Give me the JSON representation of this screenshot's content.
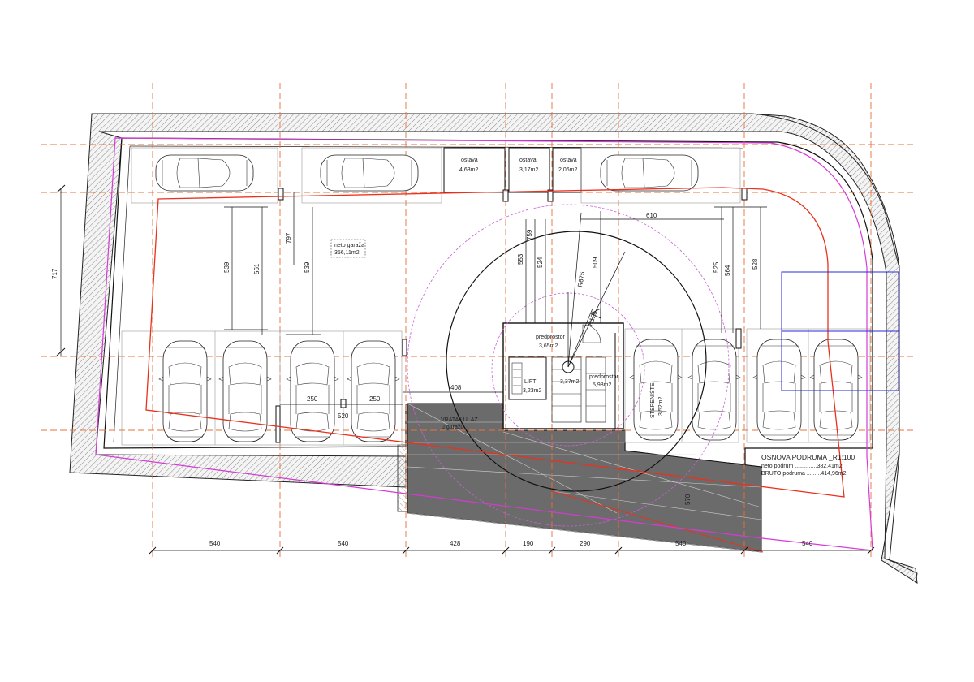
{
  "rooms": {
    "ostava1": {
      "name": "ostava",
      "area": "4,63m2"
    },
    "ostava2": {
      "name": "ostava",
      "area": "3,17m2"
    },
    "ostava3": {
      "name": "ostava",
      "area": "2,06m2"
    },
    "neto_garaza": {
      "name": "neto garaža",
      "area": "356,11m2"
    },
    "predprostor1": {
      "name": "predprostor",
      "area": "3,65m2"
    },
    "lift": {
      "name": "LIFT",
      "area": "3,23m2"
    },
    "predprostor2": {
      "name": "predprostor",
      "area": "5,98m2"
    },
    "lobby_area": "3,37m2",
    "stepeniste": {
      "name": "STEPENIŠTE",
      "area": "3,52m2"
    },
    "entrance": {
      "line1": "VRATA I ULAZ",
      "line2": "u garažu"
    }
  },
  "legend": {
    "title": "OSNOVA PODRUMA _R1:100",
    "neto": "neto podrum ..............382,41m2",
    "bruto": "BRUTO podruma .........414,96m2"
  },
  "dimensions": {
    "bottom": [
      "540",
      "540",
      "428",
      "190",
      "290",
      "540",
      "540"
    ],
    "left_717": "717",
    "v539a": "539",
    "v561": "561",
    "v797": "797",
    "v539b": "539",
    "v553": "553",
    "v759": "759",
    "v524": "524",
    "v509": "509",
    "r675": "R675",
    "r125": "R125",
    "d610": "610",
    "v525": "525",
    "v564": "564",
    "v528": "528",
    "d408": "408",
    "d250a": "250",
    "d250b": "250",
    "d520": "520",
    "d570": "570"
  },
  "colors": {
    "axis_line": "#e8703a",
    "boundary_red": "#e8321e",
    "boundary_magenta": "#d63ad6",
    "radius_circle": "#c85fd8",
    "blue_zone": "#2a2ad8",
    "ramp_fill": "#6b6b6b",
    "hatch": "#888888"
  }
}
